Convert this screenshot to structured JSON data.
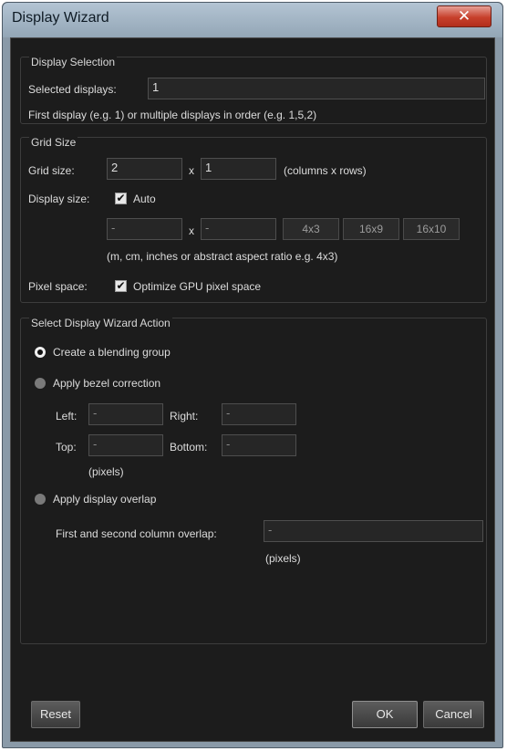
{
  "window": {
    "title": "Display Wizard",
    "close_glyph": "✕"
  },
  "display_selection": {
    "heading": "Display Selection",
    "selected_label": "Selected displays:",
    "selected_value": "1",
    "hint": "First display (e.g. 1) or multiple displays in order (e.g. 1,5,2)"
  },
  "grid_size": {
    "heading": "Grid Size",
    "grid_label": "Grid size:",
    "columns": "2",
    "times": "x",
    "rows": "1",
    "grid_hint": "(columns x rows)",
    "display_size_label": "Display size:",
    "auto_checked": true,
    "auto_label": "Auto",
    "width_value": "-",
    "height_value": "-",
    "ratio_buttons": [
      "4x3",
      "16x9",
      "16x10"
    ],
    "units_hint": "(m, cm, inches or abstract aspect ratio e.g. 4x3)",
    "pixel_space_label": "Pixel space:",
    "optimize_checked": true,
    "optimize_label": "Optimize GPU pixel space"
  },
  "action": {
    "heading": "Select Display Wizard Action",
    "blending_label": "Create a blending group",
    "blending_selected": true,
    "bezel_label": "Apply bezel correction",
    "left_label": "Left:",
    "left_value": "-",
    "right_label": "Right:",
    "right_value": "-",
    "top_label": "Top:",
    "top_value": "-",
    "bottom_label": "Bottom:",
    "bottom_value": "-",
    "pixels_label": "(pixels)",
    "overlap_label": "Apply display overlap",
    "overlap_field_label": "First and second column overlap:",
    "overlap_value": "-",
    "overlap_pixels_label": "(pixels)"
  },
  "footer": {
    "reset": "Reset",
    "ok": "OK",
    "cancel": "Cancel"
  },
  "colors": {
    "background": "#1c1c1c",
    "titlebar": "#a3b5c4",
    "close": "#c7402c"
  }
}
